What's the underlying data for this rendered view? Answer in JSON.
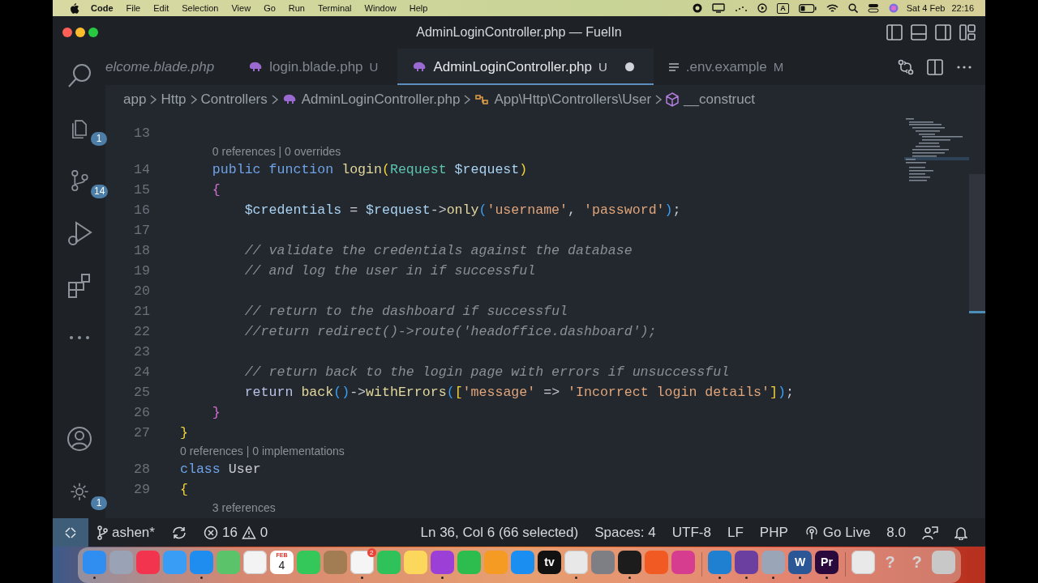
{
  "menu_bar": {
    "app_name": "Code",
    "items": [
      "File",
      "Edit",
      "Selection",
      "View",
      "Go",
      "Run",
      "Terminal",
      "Window",
      "Help"
    ],
    "input_source": "A",
    "date": "Sat 4 Feb",
    "time": "22:16"
  },
  "window": {
    "title": "AdminLoginController.php — FuelIn"
  },
  "activity_bar": [
    {
      "kind": "search"
    },
    {
      "kind": "explorer",
      "badge": "1"
    },
    {
      "kind": "source-control",
      "badge": "14"
    },
    {
      "kind": "run-debug"
    },
    {
      "kind": "extensions"
    },
    {
      "kind": "more"
    },
    {
      "kind": "spacer"
    },
    {
      "kind": "accounts"
    },
    {
      "kind": "settings",
      "badge": "1"
    }
  ],
  "tabs": [
    {
      "kind": "blade",
      "label": "elcome.blade.php",
      "preview": true,
      "selected": false,
      "modified": false
    },
    {
      "kind": "php",
      "label": "login.blade.php",
      "preview": false,
      "badge": "U",
      "selected": false,
      "modified": false
    },
    {
      "kind": "php",
      "label": "AdminLoginController.php",
      "preview": false,
      "badge": "U",
      "selected": true,
      "modified": true
    },
    {
      "kind": "text-file",
      "label": ".env.example",
      "preview": false,
      "badge": "M",
      "selected": false,
      "modified": false
    }
  ],
  "breadcrumb": [
    {
      "kind": "folder",
      "label": "app"
    },
    {
      "kind": "folder",
      "label": "Http"
    },
    {
      "kind": "folder",
      "label": "Controllers"
    },
    {
      "kind": "php",
      "label": "AdminLoginController.php"
    },
    {
      "kind": "namespace",
      "label": "App\\Http\\Controllers\\User"
    },
    {
      "kind": "method",
      "label": "__construct"
    }
  ],
  "code": [
    {
      "kind": "line",
      "number": "13"
    },
    {
      "kind": "lens",
      "text": "0 references | 0 overrides"
    },
    {
      "kind": "line",
      "number": "14",
      "tokens": [
        {
          "text": "    public",
          "kind": "keyword"
        },
        {
          "text": " function",
          "kind": "keyword"
        },
        {
          "text": " login",
          "kind": "function"
        },
        {
          "text": "(",
          "kind": "bracket1"
        },
        {
          "text": "Request",
          "kind": "type"
        },
        {
          "text": " $request",
          "kind": "variable"
        },
        {
          "text": ")",
          "kind": "bracket1"
        }
      ]
    },
    {
      "kind": "line",
      "number": "15",
      "tokens": [
        {
          "text": "    {",
          "kind": "bracket2"
        }
      ]
    },
    {
      "kind": "line",
      "number": "16",
      "tokens": [
        {
          "text": "        $credentials",
          "kind": "variable"
        },
        {
          "text": " = ",
          "kind": "plain"
        },
        {
          "text": "$request",
          "kind": "variable"
        },
        {
          "text": "->",
          "kind": "plain"
        },
        {
          "text": "only",
          "kind": "function"
        },
        {
          "text": "(",
          "kind": "bracket3"
        },
        {
          "text": "'username'",
          "kind": "string"
        },
        {
          "text": ", ",
          "kind": "plain"
        },
        {
          "text": "'password'",
          "kind": "string"
        },
        {
          "text": ")",
          "kind": "bracket3"
        },
        {
          "text": ";",
          "kind": "plain"
        }
      ]
    },
    {
      "kind": "line",
      "number": "17"
    },
    {
      "kind": "line",
      "number": "18",
      "tokens": [
        {
          "text": "        // validate the credentials against the database",
          "kind": "comment"
        }
      ]
    },
    {
      "kind": "line",
      "number": "19",
      "tokens": [
        {
          "text": "        // and log the user in if successful",
          "kind": "comment"
        }
      ]
    },
    {
      "kind": "line",
      "number": "20"
    },
    {
      "kind": "line",
      "number": "21",
      "tokens": [
        {
          "text": "        // return to the dashboard if successful",
          "kind": "comment"
        }
      ]
    },
    {
      "kind": "line",
      "number": "22",
      "tokens": [
        {
          "text": "        //return redirect()->route('headoffice.dashboard');",
          "kind": "comment"
        }
      ]
    },
    {
      "kind": "line",
      "number": "23"
    },
    {
      "kind": "line",
      "number": "24",
      "tokens": [
        {
          "text": "        // return back to the login page with errors if unsuccessful",
          "kind": "comment"
        }
      ]
    },
    {
      "kind": "line",
      "number": "25",
      "tokens": [
        {
          "text": "        return",
          "kind": "control"
        },
        {
          "text": " back",
          "kind": "function"
        },
        {
          "text": "()",
          "kind": "bracket3"
        },
        {
          "text": "->",
          "kind": "plain"
        },
        {
          "text": "withErrors",
          "kind": "function"
        },
        {
          "text": "(",
          "kind": "bracket3"
        },
        {
          "text": "[",
          "kind": "bracket1"
        },
        {
          "text": "'message'",
          "kind": "string"
        },
        {
          "text": " => ",
          "kind": "plain"
        },
        {
          "text": "'Incorrect login details'",
          "kind": "string"
        },
        {
          "text": "]",
          "kind": "bracket1"
        },
        {
          "text": ")",
          "kind": "bracket3"
        },
        {
          "text": ";",
          "kind": "plain"
        }
      ]
    },
    {
      "kind": "line",
      "number": "26",
      "tokens": [
        {
          "text": "    }",
          "kind": "bracket2"
        }
      ]
    },
    {
      "kind": "line",
      "number": "27",
      "tokens": [
        {
          "text": "}",
          "kind": "bracket1"
        }
      ]
    },
    {
      "kind": "lens",
      "text": "0 references | 0 implementations"
    },
    {
      "kind": "line",
      "number": "28",
      "tokens": [
        {
          "text": "class",
          "kind": "keyword"
        },
        {
          "text": " User",
          "kind": "plain"
        }
      ]
    },
    {
      "kind": "line",
      "number": "29",
      "tokens": [
        {
          "text": "{",
          "kind": "bracket1"
        }
      ]
    },
    {
      "kind": "lens",
      "text": "3 references"
    }
  ],
  "status_bar": {
    "left": [
      {
        "kind": "branch",
        "text": "ashen*"
      },
      {
        "kind": "sync"
      },
      {
        "kind": "problems",
        "errors": "16",
        "warnings": "0"
      }
    ],
    "right": [
      {
        "kind": "text",
        "text": "Ln 36, Col 6 (66 selected)"
      },
      {
        "kind": "text",
        "text": "Spaces: 4"
      },
      {
        "kind": "text",
        "text": "UTF-8"
      },
      {
        "kind": "text",
        "text": "LF"
      },
      {
        "kind": "text",
        "text": "PHP"
      },
      {
        "kind": "live",
        "text": "Go Live"
      },
      {
        "kind": "text",
        "text": "8.0"
      },
      {
        "kind": "feedback"
      },
      {
        "kind": "bell"
      }
    ]
  },
  "dock": [
    {
      "kind": "app",
      "color": "#2f8ef0",
      "running": true
    },
    {
      "kind": "app",
      "color": "#9aa3b5",
      "running": false
    },
    {
      "kind": "app",
      "color": "#f2344f",
      "running": false
    },
    {
      "kind": "app",
      "color": "#3a9df5",
      "running": false
    },
    {
      "kind": "app",
      "color": "#1f8cf0",
      "running": true
    },
    {
      "kind": "app",
      "color": "#5bc46a",
      "running": false
    },
    {
      "kind": "app",
      "color": "#f3f3f3",
      "running": false
    },
    {
      "kind": "calendar",
      "month": "FEB",
      "day": "4",
      "running": false
    },
    {
      "kind": "app",
      "color": "#34c759",
      "running": false
    },
    {
      "kind": "app",
      "color": "#a27c52",
      "running": false
    },
    {
      "kind": "app",
      "color": "#f5f5f5",
      "badge": "2",
      "running": true
    },
    {
      "kind": "app",
      "color": "#2fc15a",
      "running": false
    },
    {
      "kind": "app",
      "color": "#fbd75b",
      "running": false
    },
    {
      "kind": "app",
      "color": "#9b3fd6",
      "running": true
    },
    {
      "kind": "app",
      "color": "#2dbd4e",
      "running": false
    },
    {
      "kind": "app",
      "color": "#f59a23",
      "running": false
    },
    {
      "kind": "app",
      "color": "#1b8ef2",
      "running": false
    },
    {
      "kind": "app",
      "color": "#111111",
      "label": "tv",
      "running": false
    },
    {
      "kind": "app",
      "color": "#e8e8e8",
      "running": true
    },
    {
      "kind": "app",
      "color": "#7d7f84",
      "running": false
    },
    {
      "kind": "app",
      "color": "#1c1c1c",
      "running": true
    },
    {
      "kind": "app",
      "color": "#f25a24",
      "running": false
    },
    {
      "kind": "app",
      "color": "#d63d8f",
      "running": false
    },
    {
      "kind": "separator"
    },
    {
      "kind": "app",
      "color": "#1f7fd0",
      "running": true
    },
    {
      "kind": "app",
      "color": "#6b3fa0",
      "running": true
    },
    {
      "kind": "app",
      "color": "#9aa5b8",
      "running": true
    },
    {
      "kind": "app",
      "color": "#2b5797",
      "label": "W",
      "running": true
    },
    {
      "kind": "app",
      "color": "#2a0a3d",
      "label": "Pr",
      "running": true
    },
    {
      "kind": "separator"
    },
    {
      "kind": "app",
      "color": "#e9e9e9",
      "running": false
    },
    {
      "kind": "unknown",
      "label": "?",
      "running": false
    },
    {
      "kind": "unknown",
      "label": "?",
      "running": false
    },
    {
      "kind": "app",
      "color": "#c8c8c8",
      "running": false
    }
  ]
}
